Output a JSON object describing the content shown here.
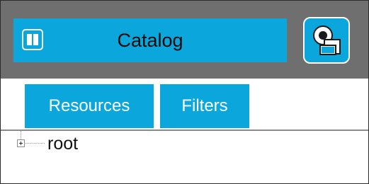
{
  "header": {
    "title": "Catalog",
    "panel_toggle_icon": "panel-columns-icon",
    "catalog_button_icon": "catalog-layers-icon",
    "accent_color": "#0aa6dc",
    "background_color": "#6f6f6f"
  },
  "tabs": [
    {
      "label": "Resources"
    },
    {
      "label": "Filters"
    }
  ],
  "tree": {
    "nodes": [
      {
        "label": "root",
        "expanded": false
      }
    ]
  }
}
